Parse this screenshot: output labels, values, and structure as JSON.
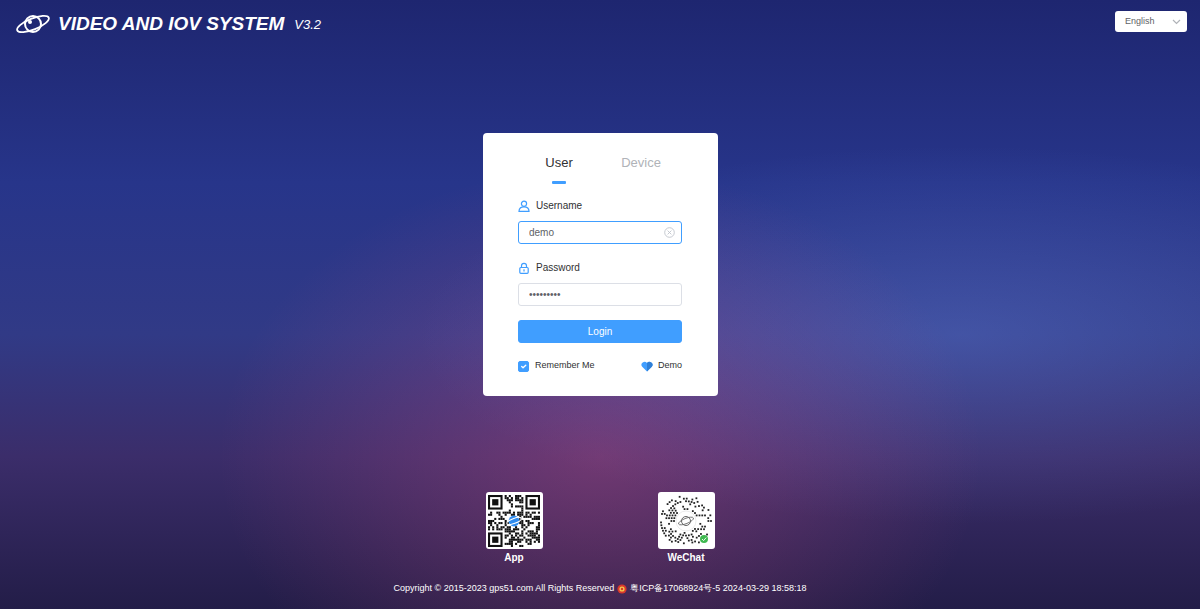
{
  "header": {
    "title": "VIDEO AND IOV SYSTEM",
    "version": "V3.2"
  },
  "language": {
    "value": "English"
  },
  "login": {
    "tabs": [
      {
        "label": "User",
        "selected": true
      },
      {
        "label": "Device",
        "selected": false
      }
    ],
    "username": {
      "label": "Username",
      "value": "demo"
    },
    "password": {
      "label": "Password",
      "value": "•••••••••"
    },
    "button": "Login",
    "remember": {
      "label": "Remember Me",
      "checked": true
    },
    "demo": {
      "label": "Demo"
    }
  },
  "qr_codes": [
    {
      "label": "App",
      "kind": "square"
    },
    {
      "label": "WeChat",
      "kind": "round"
    }
  ],
  "footer": {
    "copyright": "Copyright © 2015-2023 gps51.com All Rights Reserved",
    "license": "粤ICP备17068924号-5 2024-03-29 18:58:18"
  }
}
